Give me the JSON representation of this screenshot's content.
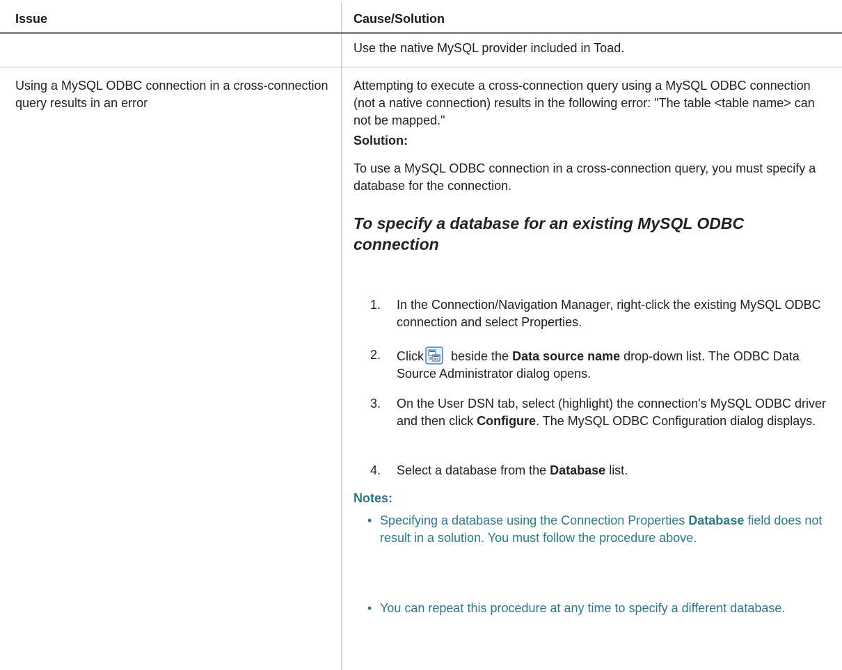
{
  "table": {
    "header": {
      "issue": "Issue",
      "cause": "Cause/Solution"
    },
    "row1": {
      "cause": "Use the native MySQL provider included in Toad."
    },
    "row2": {
      "issue": "Using a MySQL ODBC connection in a cross-connection query results in an error",
      "cause": "Attempting to execute a cross-connection query using a MySQL ODBC connection (not a native connection) results in the following error: \"The table <table name> can not be mapped.\"",
      "solution_label": "Solution:",
      "solution_text": "To use a MySQL ODBC connection in a cross-connection query, you must specify a database for the connection.",
      "procedure_heading": "To specify a database for an existing MySQL ODBC connection",
      "steps": [
        {
          "num": "1.",
          "text": "In the Connection/Navigation Manager, right-click the existing MySQL ODBC connection and select Properties."
        },
        {
          "num": "2.",
          "pre": "Click",
          "icon": "odbc-configure-icon",
          "mid": " beside the ",
          "bold": "Data source name",
          "post": " drop-down list. The ODBC Data Source Administrator dialog opens."
        },
        {
          "num": "3.",
          "pre": "On the User DSN tab, select (highlight) the connection's MySQL ODBC driver and then click ",
          "bold": "Configure",
          "post": ". The MySQL ODBC Configuration dialog displays."
        },
        {
          "num": "4.",
          "pre": "Select a database from the ",
          "bold": "Database",
          "post": " list."
        }
      ],
      "notes_label": "Notes:",
      "notes": [
        {
          "pre": "Specifying a database using the Connection Properties ",
          "bold": "Database",
          "post": " field does not result in a solution. You must follow the procedure above."
        },
        {
          "text": "You can repeat this procedure at any time to specify a different database."
        }
      ]
    }
  },
  "colors": {
    "notes": "#2a7a8c",
    "rule": "#8c8c8c",
    "divider": "#c4c4c4"
  }
}
